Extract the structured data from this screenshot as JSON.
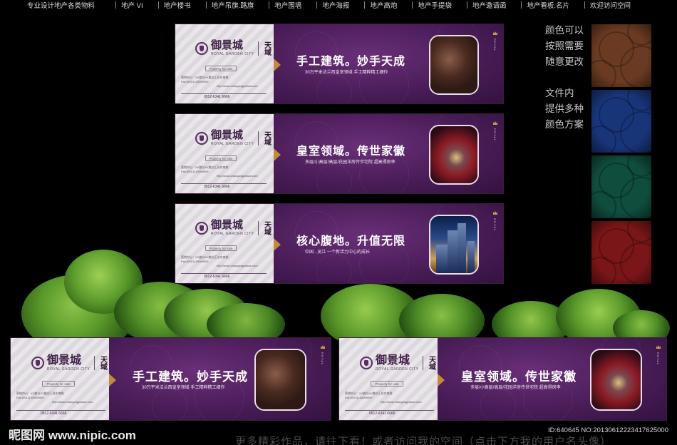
{
  "nav": {
    "items": [
      "专业设计地产各类物料",
      "地产 VI",
      "地产楼书",
      "地产吊旗.路旗",
      "地产围墙",
      "地产海报",
      "地产高炮",
      "地产手提袋",
      "地产邀请函",
      "地产看板.名片",
      "欢迎访问空间"
    ]
  },
  "swatch_panel": {
    "note_lines": [
      "颜色可以",
      "按照需要",
      "随意更改",
      "",
      "文件内",
      "提供多种",
      "颜色方案"
    ],
    "colors": [
      "#6a3b22",
      "#19357a",
      "#0f4d3c",
      "#7a1618"
    ]
  },
  "brand": {
    "logo_name": "御景城",
    "logo_sub": "ROYAL GARDEN CITY",
    "logo_tian": "天域",
    "pill": "Property for sale",
    "address_1": "营销中心：XX路与XX路交汇处东南角",
    "address_2": "Fax:(0513)-63069009",
    "address_3": "http://www.changangpalace.com",
    "phone": "0512-6341 6666",
    "brandmark": "ROYAL"
  },
  "banners": [
    {
      "headline": "手工建筑。妙手天成",
      "tagline": "30万平米法兰西皇室领域    手工精粹精工细作",
      "photo": "photo-hands"
    },
    {
      "headline": "皇室领域。传世家徽",
      "tagline": "多层/小高层/高层/花园洋房传世宅院 超高得房率",
      "photo": "photo-crown"
    },
    {
      "headline": "核心腹地。升值无限",
      "tagline": "中国 · 吴江 一个新活力中心的成长",
      "photo": "photo-city"
    },
    {
      "headline": "手工建筑。妙手天成",
      "tagline": "30万平米法兰西皇室领域    手工精粹精工细作",
      "photo": "photo-hands"
    },
    {
      "headline": "皇室领域。传世家徽",
      "tagline": "多层/小高层/高层/花园洋房传世宅院 超高得房率",
      "photo": "photo-crown"
    }
  ],
  "watermark": {
    "site": "昵图网 www.nipic.com",
    "footer_cta": "更多精彩作品，请往下看！或者访问我的空间（点击下方我的用户名头像）",
    "id_text": "ID:640645 NO:20130612223417625000"
  }
}
